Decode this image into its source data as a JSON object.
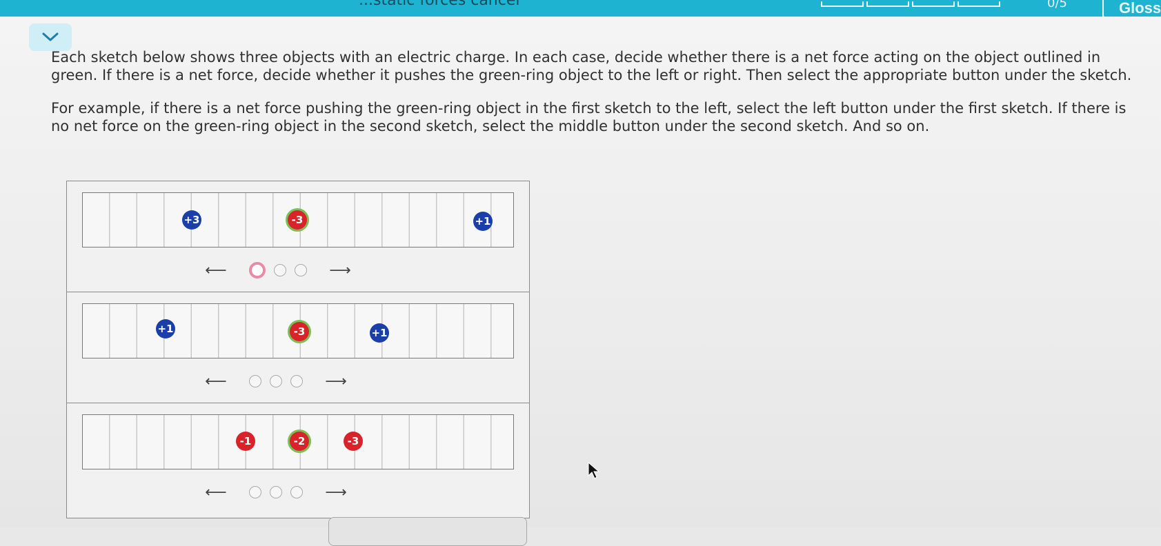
{
  "header": {
    "title_fragment": "...static forces cancel",
    "progress": {
      "value": 0,
      "total": 5,
      "label": "0/5"
    },
    "glossary_label": "Glossa"
  },
  "instructions": {
    "paragraph1": "Each sketch below shows three objects with an electric charge. In each case, decide whether there is a net force acting on the object outlined in green. If there is a net force, decide whether it pushes the green-ring object to the left or right. Then select the appropriate button under the sketch.",
    "paragraph2": "For example, if there is a net force pushing the green-ring object in the first sketch to the left, select the left button under the first sketch. If there is no net force on the green-ring object in the second sketch, select the middle button under the second sketch. And so on."
  },
  "sketches": [
    {
      "charges": [
        {
          "label": "+3",
          "sign": "positive",
          "target": false
        },
        {
          "label": "-3",
          "sign": "negative",
          "target": true
        },
        {
          "label": "+1",
          "sign": "positive",
          "target": false
        }
      ],
      "answer": {
        "left_arrow": "⟵",
        "right_arrow": "⟶",
        "selected": "left"
      }
    },
    {
      "charges": [
        {
          "label": "+1",
          "sign": "positive",
          "target": false
        },
        {
          "label": "-3",
          "sign": "negative",
          "target": true
        },
        {
          "label": "+1",
          "sign": "positive",
          "target": false
        }
      ],
      "answer": {
        "left_arrow": "⟵",
        "right_arrow": "⟶",
        "selected": "none"
      }
    },
    {
      "charges": [
        {
          "label": "-1",
          "sign": "negative",
          "target": false
        },
        {
          "label": "-2",
          "sign": "negative",
          "target": true
        },
        {
          "label": "-3",
          "sign": "negative",
          "target": false
        }
      ],
      "answer": {
        "left_arrow": "⟵",
        "right_arrow": "⟶",
        "selected": "none"
      }
    }
  ],
  "colors": {
    "header": "#1fb3d2",
    "positive_charge": "#1a3fa8",
    "negative_charge": "#d8232a",
    "target_ring": "#7bbf55",
    "selected_radio": "#e88aa8"
  },
  "icons": {
    "collapse": "chevron-down-icon",
    "cursor": "mouse-pointer-icon"
  }
}
